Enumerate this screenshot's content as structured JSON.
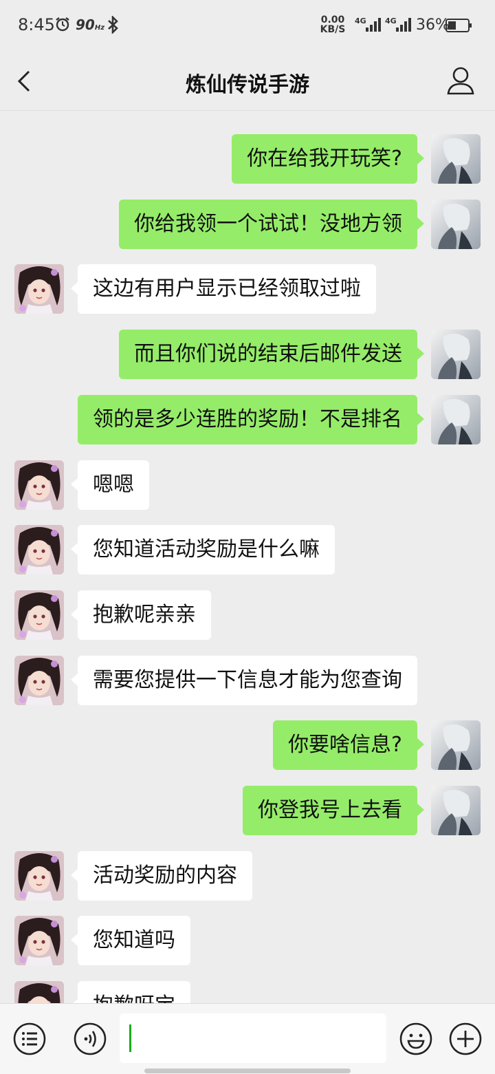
{
  "status_bar": {
    "time": "8:45",
    "refresh_rate": "90",
    "refresh_unit": "Hz",
    "net_speed_value": "0.00",
    "net_speed_unit": "KB/S",
    "signal1": "4G",
    "signal2": "4G",
    "battery": "36%"
  },
  "nav": {
    "title": "炼仙传说手游",
    "back_icon": "chevron-left-icon",
    "profile_icon": "person-icon"
  },
  "messages": [
    {
      "side": "right",
      "text": "你在给我开玩笑?"
    },
    {
      "side": "right",
      "text": "你给我领一个试试！没地方领"
    },
    {
      "side": "left",
      "text": "这边有用户显示已经领取过啦"
    },
    {
      "side": "right",
      "text": "而且你们说的结束后邮件发送"
    },
    {
      "side": "right",
      "text": "领的是多少连胜的奖励！不是排名"
    },
    {
      "side": "left",
      "text": "嗯嗯"
    },
    {
      "side": "left",
      "text": "您知道活动奖励是什么嘛"
    },
    {
      "side": "left",
      "text": "抱歉呢亲亲"
    },
    {
      "side": "left",
      "text": "需要您提供一下信息才能为您查询"
    },
    {
      "side": "right",
      "text": "你要啥信息?"
    },
    {
      "side": "right",
      "text": "你登我号上去看"
    },
    {
      "side": "left",
      "text": "活动奖励的内容"
    },
    {
      "side": "left",
      "text": "您知道吗"
    },
    {
      "side": "left",
      "text": "抱歉呀宝"
    }
  ],
  "input_bar": {
    "message_value": "",
    "icons": [
      "list-icon",
      "voice-icon",
      "emoji-icon",
      "plus-icon"
    ]
  },
  "colors": {
    "background": "#ededed",
    "sent_bubble": "#95ec69",
    "received_bubble": "#ffffff",
    "cursor": "#1aad19"
  }
}
